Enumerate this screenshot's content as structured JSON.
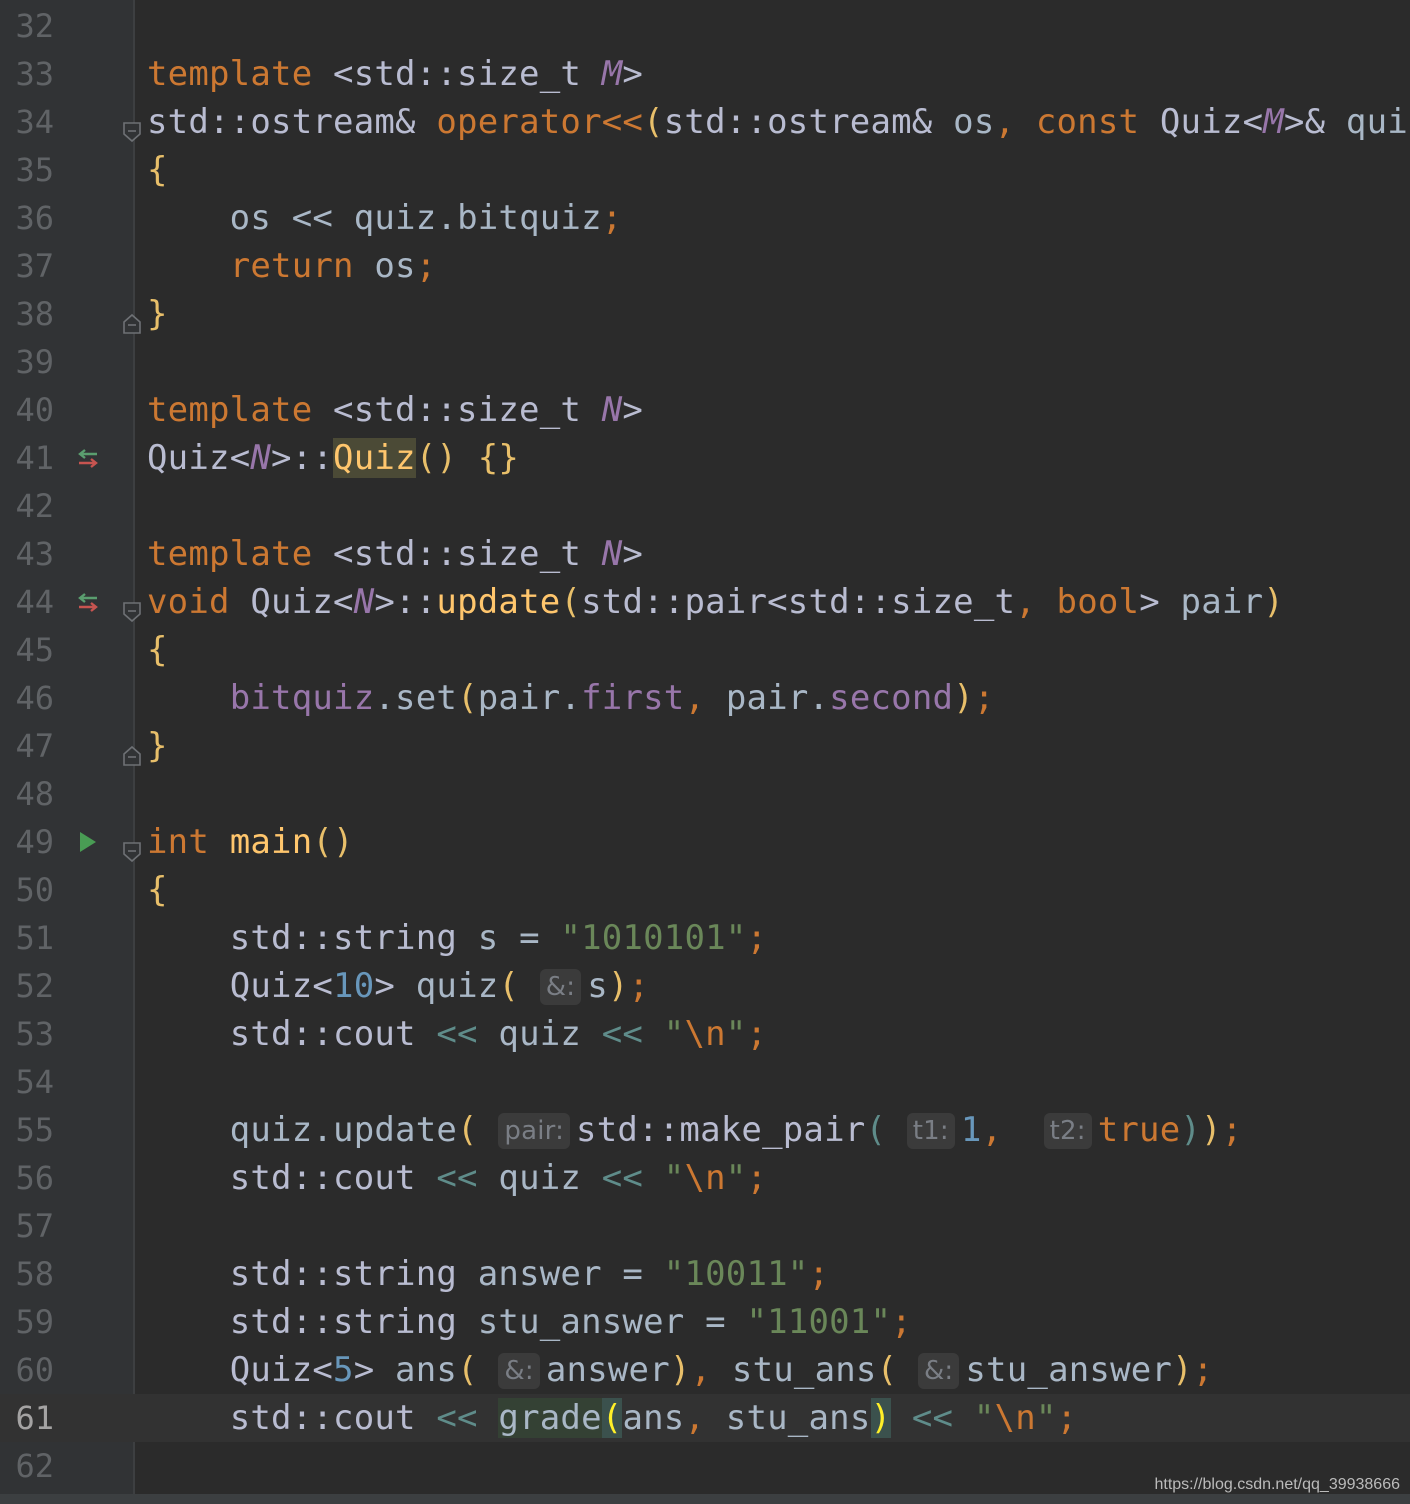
{
  "editor": {
    "current_line": "61",
    "lines": [
      {
        "n": "32"
      },
      {
        "n": "33",
        "tokens": [
          {
            "t": "template",
            "c": "kw"
          },
          {
            "t": " "
          },
          {
            "t": "<",
            "c": "ty"
          },
          {
            "t": "std::size_t",
            "c": "ty"
          },
          {
            "t": " "
          },
          {
            "t": "M",
            "c": "tp"
          },
          {
            "t": ">",
            "c": "ty"
          }
        ]
      },
      {
        "n": "34",
        "fold": "open",
        "tokens": [
          {
            "t": "std::ostream&",
            "c": "ty"
          },
          {
            "t": " "
          },
          {
            "t": "operator<<",
            "c": "kw"
          },
          {
            "t": "(",
            "c": "br"
          },
          {
            "t": "std::ostream&",
            "c": "ty"
          },
          {
            "t": " os"
          },
          {
            "t": ", ",
            "c": "pn"
          },
          {
            "t": "const",
            "c": "kw"
          },
          {
            "t": " "
          },
          {
            "t": "Quiz",
            "c": "ty"
          },
          {
            "t": "<",
            "c": "ty"
          },
          {
            "t": "M",
            "c": "tp"
          },
          {
            "t": ">&",
            "c": "ty"
          },
          {
            "t": " quiz"
          },
          {
            "t": ")",
            "c": "br"
          }
        ]
      },
      {
        "n": "35",
        "tokens": [
          {
            "t": "{",
            "c": "br"
          }
        ]
      },
      {
        "n": "36",
        "tokens": [
          {
            "t": "    os "
          },
          {
            "t": "<<"
          },
          {
            "t": " quiz.bitquiz"
          },
          {
            "t": ";",
            "c": "pn"
          }
        ]
      },
      {
        "n": "37",
        "tokens": [
          {
            "t": "    "
          },
          {
            "t": "return",
            "c": "kw"
          },
          {
            "t": " os"
          },
          {
            "t": ";",
            "c": "pn"
          }
        ]
      },
      {
        "n": "38",
        "fold": "close",
        "tokens": [
          {
            "t": "}",
            "c": "br"
          }
        ]
      },
      {
        "n": "39"
      },
      {
        "n": "40",
        "tokens": [
          {
            "t": "template",
            "c": "kw"
          },
          {
            "t": " "
          },
          {
            "t": "<std::size_t",
            "c": "ty"
          },
          {
            "t": " "
          },
          {
            "t": "N",
            "c": "tp"
          },
          {
            "t": ">",
            "c": "ty"
          }
        ]
      },
      {
        "n": "41",
        "marker": "override",
        "tokens": [
          {
            "t": "Quiz",
            "c": "ty"
          },
          {
            "t": "<",
            "c": "ty"
          },
          {
            "t": "N",
            "c": "tp"
          },
          {
            "t": ">::",
            "c": "ty"
          },
          {
            "t": "Quiz",
            "c": "fn hl-quiz"
          },
          {
            "t": "()",
            "c": "br"
          },
          {
            "t": " "
          },
          {
            "t": "{}",
            "c": "br"
          }
        ]
      },
      {
        "n": "42"
      },
      {
        "n": "43",
        "tokens": [
          {
            "t": "template",
            "c": "kw"
          },
          {
            "t": " "
          },
          {
            "t": "<std::size_t",
            "c": "ty"
          },
          {
            "t": " "
          },
          {
            "t": "N",
            "c": "tp"
          },
          {
            "t": ">",
            "c": "ty"
          }
        ]
      },
      {
        "n": "44",
        "marker": "override",
        "fold": "open",
        "tokens": [
          {
            "t": "void",
            "c": "kw"
          },
          {
            "t": " "
          },
          {
            "t": "Quiz",
            "c": "ty"
          },
          {
            "t": "<",
            "c": "ty"
          },
          {
            "t": "N",
            "c": "tp"
          },
          {
            "t": ">::",
            "c": "ty"
          },
          {
            "t": "update",
            "c": "fn"
          },
          {
            "t": "(",
            "c": "br"
          },
          {
            "t": "std::pair<std::size_t",
            "c": "ty"
          },
          {
            "t": ", ",
            "c": "pn"
          },
          {
            "t": "bool",
            "c": "kw"
          },
          {
            "t": ">",
            "c": "ty"
          },
          {
            "t": " pair"
          },
          {
            "t": ")",
            "c": "br"
          }
        ]
      },
      {
        "n": "45",
        "tokens": [
          {
            "t": "{",
            "c": "br"
          }
        ]
      },
      {
        "n": "46",
        "tokens": [
          {
            "t": "    "
          },
          {
            "t": "bitquiz",
            "c": "mem"
          },
          {
            "t": ".set"
          },
          {
            "t": "(",
            "c": "br"
          },
          {
            "t": "pair."
          },
          {
            "t": "first",
            "c": "mem"
          },
          {
            "t": ", ",
            "c": "pn"
          },
          {
            "t": "pair."
          },
          {
            "t": "second",
            "c": "mem"
          },
          {
            "t": ")",
            "c": "br"
          },
          {
            "t": ";",
            "c": "pn"
          }
        ]
      },
      {
        "n": "47",
        "fold": "close",
        "tokens": [
          {
            "t": "}",
            "c": "br"
          }
        ]
      },
      {
        "n": "48"
      },
      {
        "n": "49",
        "marker": "run",
        "fold": "open",
        "tokens": [
          {
            "t": "int",
            "c": "kw"
          },
          {
            "t": " "
          },
          {
            "t": "main",
            "c": "fn"
          },
          {
            "t": "()",
            "c": "br"
          }
        ]
      },
      {
        "n": "50",
        "tokens": [
          {
            "t": "{",
            "c": "br"
          }
        ]
      },
      {
        "n": "51",
        "tokens": [
          {
            "t": "    "
          },
          {
            "t": "std::string",
            "c": "ty"
          },
          {
            "t": " s = "
          },
          {
            "t": "\"1010101\"",
            "c": "st"
          },
          {
            "t": ";",
            "c": "pn"
          }
        ]
      },
      {
        "n": "52",
        "tokens": [
          {
            "t": "    "
          },
          {
            "t": "Quiz",
            "c": "ty"
          },
          {
            "t": "<",
            "c": "ty"
          },
          {
            "t": "10",
            "c": "num"
          },
          {
            "t": ">",
            "c": "ty"
          },
          {
            "t": " quiz"
          },
          {
            "t": "(",
            "c": "br"
          },
          {
            "t": " "
          },
          {
            "hint": "&:"
          },
          {
            "t": "s"
          },
          {
            "t": ")",
            "c": "br"
          },
          {
            "t": ";",
            "c": "pn"
          }
        ]
      },
      {
        "n": "53",
        "tokens": [
          {
            "t": "    "
          },
          {
            "t": "std::cout",
            "c": "ty"
          },
          {
            "t": " "
          },
          {
            "t": "<<",
            "c": "op"
          },
          {
            "t": " quiz "
          },
          {
            "t": "<<",
            "c": "op"
          },
          {
            "t": " "
          },
          {
            "t": "\"",
            "c": "st"
          },
          {
            "t": "\\n",
            "c": "esc"
          },
          {
            "t": "\"",
            "c": "st"
          },
          {
            "t": ";",
            "c": "pn"
          }
        ]
      },
      {
        "n": "54"
      },
      {
        "n": "55",
        "tokens": [
          {
            "t": "    quiz.update"
          },
          {
            "t": "(",
            "c": "br"
          },
          {
            "t": " "
          },
          {
            "hint": "pair:"
          },
          {
            "t": "std::make_pair",
            "c": "ty"
          },
          {
            "t": "(",
            "c": "op"
          },
          {
            "t": " "
          },
          {
            "hint": "t1:"
          },
          {
            "t": "1",
            "c": "num"
          },
          {
            "t": ", ",
            "c": "pn"
          },
          {
            "t": " "
          },
          {
            "hint": "t2:"
          },
          {
            "t": "true",
            "c": "kw"
          },
          {
            "t": ")",
            "c": "op"
          },
          {
            "t": ")",
            "c": "br"
          },
          {
            "t": ";",
            "c": "pn"
          }
        ]
      },
      {
        "n": "56",
        "tokens": [
          {
            "t": "    "
          },
          {
            "t": "std::cout",
            "c": "ty"
          },
          {
            "t": " "
          },
          {
            "t": "<<",
            "c": "op"
          },
          {
            "t": " quiz "
          },
          {
            "t": "<<",
            "c": "op"
          },
          {
            "t": " "
          },
          {
            "t": "\"",
            "c": "st"
          },
          {
            "t": "\\n",
            "c": "esc"
          },
          {
            "t": "\"",
            "c": "st"
          },
          {
            "t": ";",
            "c": "pn"
          }
        ]
      },
      {
        "n": "57"
      },
      {
        "n": "58",
        "tokens": [
          {
            "t": "    "
          },
          {
            "t": "std::string",
            "c": "ty"
          },
          {
            "t": " answer = "
          },
          {
            "t": "\"10011\"",
            "c": "st"
          },
          {
            "t": ";",
            "c": "pn"
          }
        ]
      },
      {
        "n": "59",
        "tokens": [
          {
            "t": "    "
          },
          {
            "t": "std::string",
            "c": "ty"
          },
          {
            "t": " stu_answer = "
          },
          {
            "t": "\"11001\"",
            "c": "st"
          },
          {
            "t": ";",
            "c": "pn"
          }
        ]
      },
      {
        "n": "60",
        "tokens": [
          {
            "t": "    "
          },
          {
            "t": "Quiz",
            "c": "ty"
          },
          {
            "t": "<",
            "c": "ty"
          },
          {
            "t": "5",
            "c": "num"
          },
          {
            "t": ">",
            "c": "ty"
          },
          {
            "t": " ans"
          },
          {
            "t": "(",
            "c": "br"
          },
          {
            "t": " "
          },
          {
            "hint": "&:"
          },
          {
            "t": "answer"
          },
          {
            "t": ")",
            "c": "br"
          },
          {
            "t": ", ",
            "c": "pn"
          },
          {
            "t": "stu_ans"
          },
          {
            "t": "(",
            "c": "br"
          },
          {
            "t": " "
          },
          {
            "hint": "&:"
          },
          {
            "t": "stu_answer"
          },
          {
            "t": ")",
            "c": "br"
          },
          {
            "t": ";",
            "c": "pn"
          }
        ]
      },
      {
        "n": "61",
        "current": true,
        "tokens": [
          {
            "t": "    "
          },
          {
            "t": "std::cout",
            "c": "ty"
          },
          {
            "t": " "
          },
          {
            "t": "<<",
            "c": "op"
          },
          {
            "t": " "
          },
          {
            "t": "grade",
            "c": "hl-grade"
          },
          {
            "t": "(",
            "c": "hl-paren"
          },
          {
            "t": "ans"
          },
          {
            "t": ", ",
            "c": "pn"
          },
          {
            "t": "stu_ans"
          },
          {
            "t": ")",
            "c": "hl-paren"
          },
          {
            "t": " "
          },
          {
            "t": "<<",
            "c": "op"
          },
          {
            "t": " "
          },
          {
            "t": "\"",
            "c": "st"
          },
          {
            "t": "\\n",
            "c": "esc"
          },
          {
            "t": "\"",
            "c": "st"
          },
          {
            "t": ";",
            "c": "pn"
          }
        ]
      },
      {
        "n": "62"
      }
    ]
  },
  "icons": {
    "override": "override-arrows-icon",
    "run": "run-triangle-icon",
    "fold_open": "fold-open-icon",
    "fold_close": "fold-close-icon"
  },
  "colors": {
    "background": "#2b2b2b",
    "gutter": "#313335",
    "keyword": "#cc7832",
    "type": "#b9bcd1",
    "template_param": "#9876aa",
    "function": "#ffc66d",
    "string": "#6a8759",
    "number": "#6897bb",
    "run": "#499c54",
    "override": "#c75450"
  },
  "watermark": "https://blog.csdn.net/qq_39938666"
}
